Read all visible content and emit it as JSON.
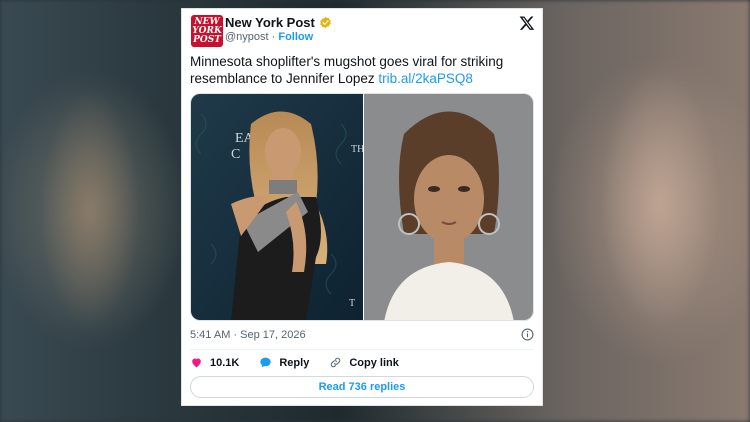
{
  "account": {
    "name": "New York Post",
    "handle": "@nypost",
    "separator": " · ",
    "follow_label": "Follow",
    "logo_line1": "NEW",
    "logo_line2": "YORK",
    "logo_line3": "POST",
    "brand_color": "#c8102e",
    "verified_color": "#e8b20c"
  },
  "tweet": {
    "text": "Minnesota shoplifter's mugshot goes viral for striking resemblance to Jennifer Lopez ",
    "link": "trib.al/2kaPSQ8",
    "timestamp": "5:41 AM · Sep 17, 2026"
  },
  "media": {
    "left_backdrop_text_1": "EA",
    "left_backdrop_text_2": "C",
    "left_backdrop_text_3": "TH",
    "left_backdrop_text_4": "T"
  },
  "actions": {
    "likes": "10.1K",
    "reply_label": "Reply",
    "copy_label": "Copy link",
    "like_color": "#f91880",
    "reply_color": "#1d9bf0"
  },
  "replies_button": "Read 736 replies",
  "icons": [
    "x-logo-icon",
    "verified-badge-icon",
    "info-icon",
    "heart-icon",
    "reply-bubble-icon",
    "link-icon"
  ]
}
